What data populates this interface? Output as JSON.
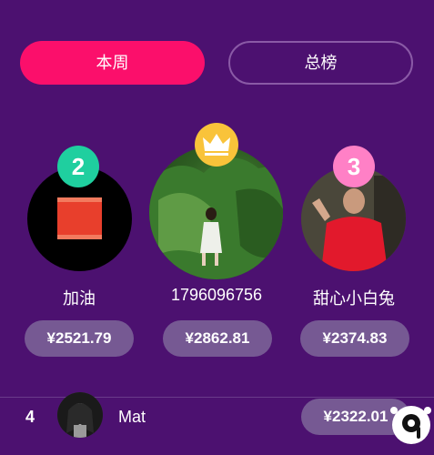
{
  "tabs": {
    "week": "本周",
    "total": "总榜"
  },
  "podium": [
    {
      "rank": "2",
      "name": "加油",
      "amount": "¥2521.79"
    },
    {
      "rank": "1",
      "name": "1796096756",
      "amount": "¥2862.81"
    },
    {
      "rank": "3",
      "name": "甜心小白兔",
      "amount": "¥2374.83"
    }
  ],
  "list": [
    {
      "rank": "4",
      "name": "Mat",
      "amount": "¥2322.01"
    }
  ],
  "colors": {
    "background": "#4c1170",
    "accent": "#fb0f6b",
    "rank2_badge": "#1fcf9f",
    "rank3_badge": "#ff80c6",
    "crown": "#f9c33a",
    "amount_pill": "#765993"
  }
}
